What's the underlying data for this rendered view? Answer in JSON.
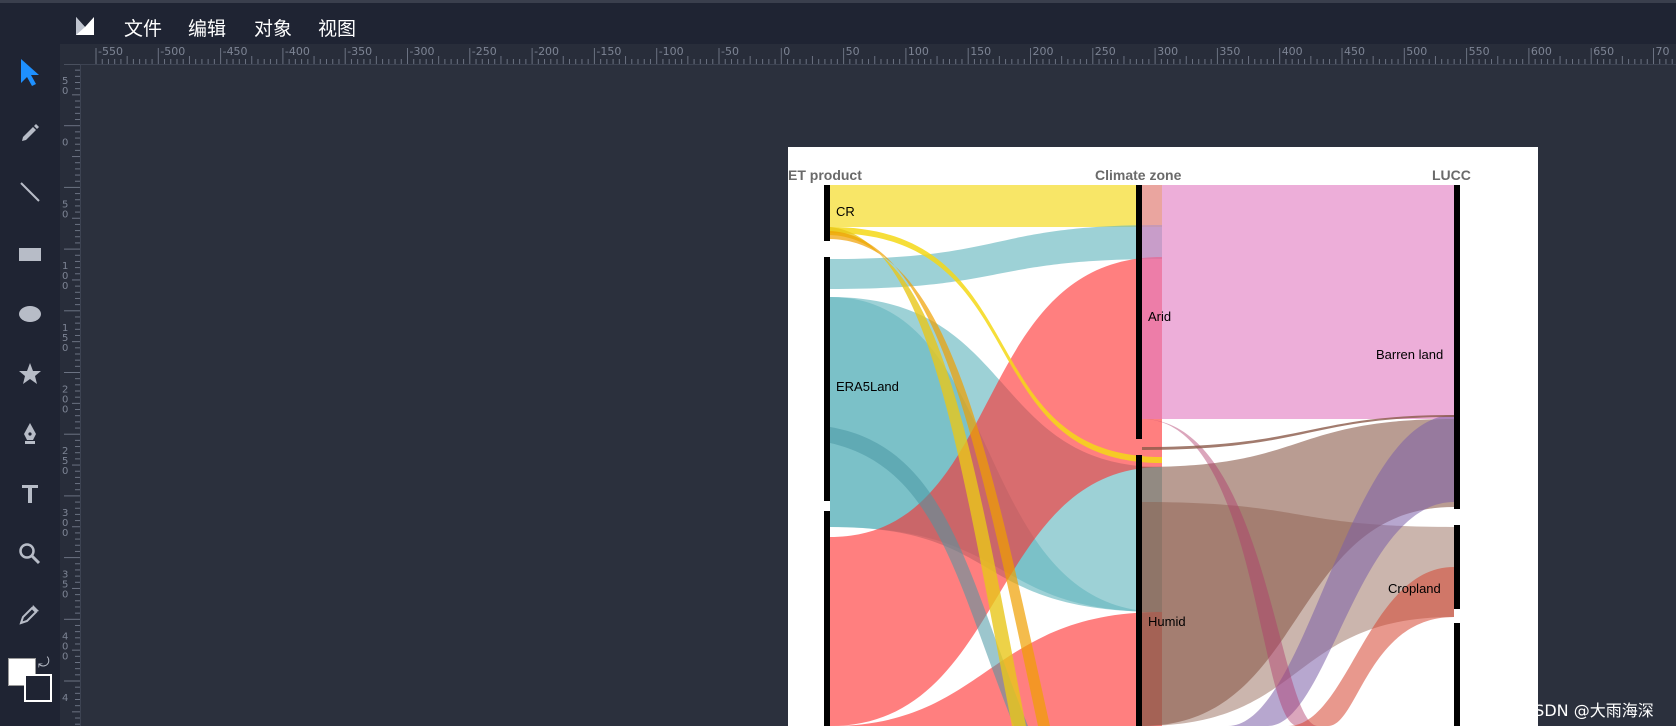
{
  "menu": {
    "items": [
      "文件",
      "编辑",
      "对象",
      "视图"
    ]
  },
  "toolbar": {
    "tools": [
      "select-arrow-icon",
      "pencil-icon",
      "line-icon",
      "rectangle-icon",
      "ellipse-icon",
      "star-icon",
      "pen-icon",
      "text-icon",
      "zoom-icon",
      "eyedropper-icon"
    ],
    "active_color": "#1e90ff",
    "fill_color": "#ffffff",
    "stroke_color": "#ffffff"
  },
  "ruler": {
    "top_labels": [
      "-550",
      "-500",
      "-450",
      "-400",
      "-350",
      "-300",
      "-250",
      "-200",
      "-150",
      "-100",
      "-50",
      "0",
      "50",
      "100",
      "150",
      "200",
      "250",
      "300",
      "350",
      "400",
      "450",
      "500",
      "550",
      "600",
      "650",
      "70"
    ],
    "left_labels": [
      "5\n0",
      "0",
      "5\n0",
      "1\n0\n0",
      "1\n5\n0",
      "2\n0\n0",
      "2\n5\n0",
      "3\n0\n0",
      "3\n5\n0",
      "4\n0\n0",
      "4"
    ]
  },
  "sankey": {
    "stage_titles": [
      "ET product",
      "Climate zone",
      "LUCC"
    ],
    "nodes": {
      "cr": "CR",
      "era5land": "ERA5Land",
      "arid": "Arid",
      "humid": "Humid",
      "barren": "Barren land",
      "cropland": "Cropland"
    },
    "colors": {
      "cr": "#f5d816",
      "era5land": "#69b8c0",
      "third_product": "#ff2a2a",
      "arid": "#e27cc2",
      "humid": "#8b5a4a",
      "barren_purple": "#7b5ea8"
    }
  },
  "watermark": "CSDN @大雨海深"
}
